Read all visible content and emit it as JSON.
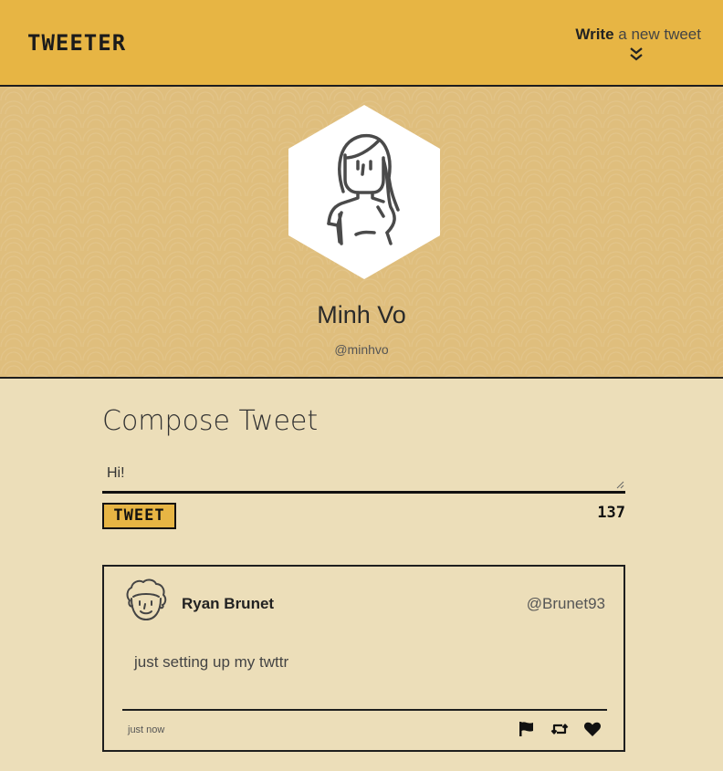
{
  "nav": {
    "brand": "TWEETER",
    "write_bold": "Write",
    "write_rest": " a new tweet",
    "chevron_icon": "double-chevron-down-icon"
  },
  "profile": {
    "name": "Minh Vo",
    "handle": "@minhvo",
    "avatar_icon": "woman-avatar-icon"
  },
  "compose": {
    "title": "Compose Tweet",
    "input_value": "Hi!",
    "button_label": "TWEET",
    "counter": "137"
  },
  "tweets": [
    {
      "avatar_icon": "curly-hair-avatar-icon",
      "name": "Ryan Brunet",
      "handle": "@Brunet93",
      "text": "just setting up my twttr",
      "time": "just now",
      "actions": [
        "flag-icon",
        "retweet-icon",
        "heart-icon"
      ]
    }
  ],
  "colors": {
    "accent": "#e7b544",
    "banner": "#dfbe7d",
    "page_bg": "#ecdeb9",
    "ink": "#1e1e1e"
  }
}
